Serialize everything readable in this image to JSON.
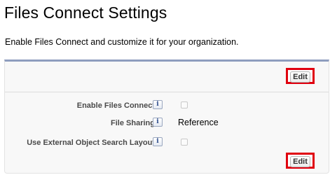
{
  "page": {
    "title": "Files Connect Settings",
    "description": "Enable Files Connect and customize it for your organization."
  },
  "panel": {
    "edit_label": "Edit",
    "fields": [
      {
        "label": "Enable Files Connect",
        "type": "checkbox",
        "checked": false,
        "info_icon": "i"
      },
      {
        "label": "File Sharing",
        "type": "text",
        "value": "Reference",
        "info_icon": "i"
      },
      {
        "label": "Use External Object Search Layout",
        "type": "checkbox",
        "checked": false,
        "info_icon": "i"
      }
    ]
  },
  "colors": {
    "highlight_outline": "#e0000f",
    "panel_top_border": "#8e9dbe",
    "panel_background": "#f8f8f8"
  }
}
